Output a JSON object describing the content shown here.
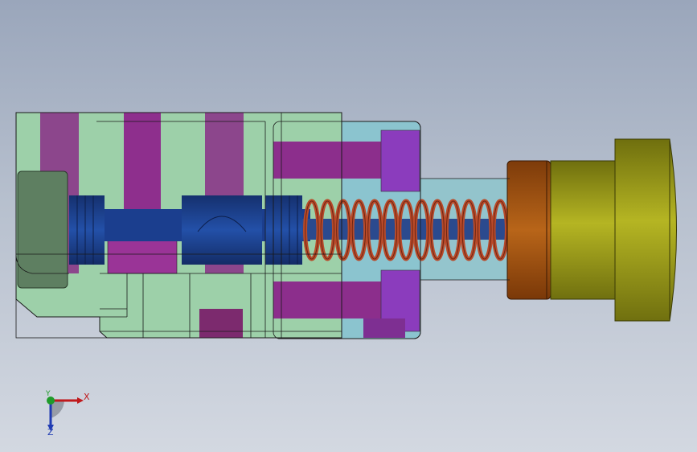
{
  "viewport": {
    "colors": {
      "background_top": "#9aa6bb",
      "background_bottom": "#d3d8e1",
      "housing": "#9cd0a8",
      "housing_edge": "#1a1a1a",
      "end_block": "#8fc7cf",
      "spool": "#1c3d8c",
      "bolts": "#8a2f8a",
      "bolt_heads": "#8a3bbe",
      "spring": "#b84a2a",
      "spring_seat": "#b35f14",
      "knob": "#a9a91a",
      "plug": "#5f7f62"
    }
  },
  "triad": {
    "x_label": "X",
    "y_label": "Y",
    "z_label": "Z",
    "x_color": "#c0191c",
    "y_color": "#1f9b2a",
    "z_color": "#1f3bb3"
  }
}
